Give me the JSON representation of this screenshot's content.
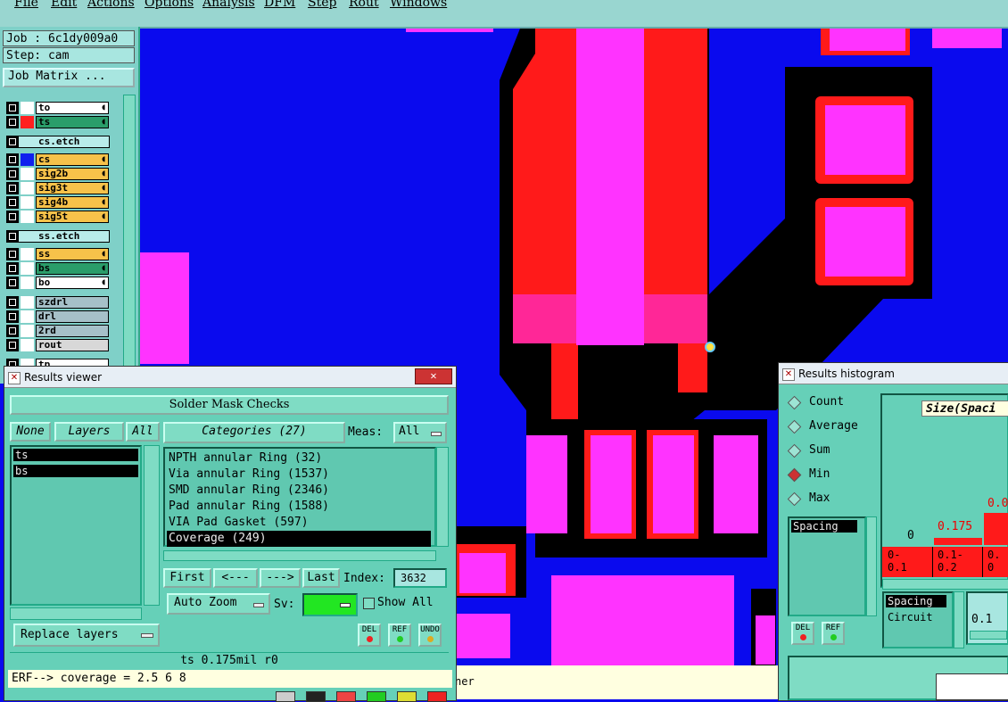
{
  "menu": [
    "File",
    "Edit",
    "Actions",
    "Options",
    "Analysis",
    "DFM",
    "Step",
    "Rout",
    "Windows"
  ],
  "job": {
    "job_label": "Job : 6c1dy009a0",
    "step_label": "Step: cam",
    "matrix_button": "Job Matrix ..."
  },
  "layers": [
    {
      "name": "to",
      "color": "#ffffff",
      "swatch": "#ffffff",
      "group": 1
    },
    {
      "name": "ts",
      "color": "#2a9d6a",
      "swatch": "#ff2020",
      "group": 1
    },
    {
      "name": "cs.etch",
      "sep": true
    },
    {
      "name": "cs",
      "color": "#f7c24a",
      "swatch": "#1020ee",
      "group": 2
    },
    {
      "name": "sig2b",
      "color": "#f7c24a",
      "swatch": "#ffffff",
      "group": 2
    },
    {
      "name": "sig3t",
      "color": "#f7c24a",
      "swatch": "#ffffff",
      "group": 2
    },
    {
      "name": "sig4b",
      "color": "#f7c24a",
      "swatch": "#ffffff",
      "group": 2
    },
    {
      "name": "sig5t",
      "color": "#f7c24a",
      "swatch": "#ffffff",
      "group": 2
    },
    {
      "name": "ss.etch",
      "sep": true
    },
    {
      "name": "ss",
      "color": "#f7c24a",
      "swatch": "#ffffff",
      "group": 3
    },
    {
      "name": "bs",
      "color": "#2a9d6a",
      "swatch": "#ffffff",
      "group": 3
    },
    {
      "name": "bo",
      "color": "#ffffff",
      "swatch": "#ffffff",
      "group": 3
    },
    {
      "name": "szdrl",
      "color": "#a6c0c8",
      "swatch": "#ffffff",
      "group": 4
    },
    {
      "name": "drl",
      "color": "#a6c0c8",
      "swatch": "#ffffff",
      "group": 4
    },
    {
      "name": "2rd",
      "color": "#a6c0c8",
      "swatch": "#ffffff",
      "group": 4
    },
    {
      "name": "rout",
      "color": "#d8d8d8",
      "swatch": "#ffffff",
      "group": 4
    },
    {
      "name": "tp",
      "color": "#ffffff",
      "swatch": "#ffffff",
      "group": 5
    }
  ],
  "results_viewer": {
    "title": "Results viewer",
    "heading": "Solder Mask Checks",
    "none_btn": "None",
    "layers_btn": "Layers",
    "all_btn": "All",
    "layer_items": [
      "ts",
      "bs"
    ],
    "categories_btn": "Categories (27)",
    "meas_label": "Meas:",
    "meas_value": "All",
    "categories": [
      "NPTH annular Ring (32)",
      "Via annular Ring (1537)",
      "SMD annular Ring (2346)",
      "Pad annular Ring (1588)",
      "VIA Pad Gasket (597)",
      "Coverage (249)"
    ],
    "first_btn": "First",
    "prev_btn": "<---",
    "next_btn": "--->",
    "last_btn": "Last",
    "index_label": "Index:",
    "index_value": "3632",
    "auto_zoom": "Auto Zoom",
    "sv_label": "Sv:",
    "show_all": "Show All",
    "replace_layers": "Replace layers",
    "del": "DEL",
    "ref": "REF",
    "undo": "UNDO",
    "status": "ts 0.175mil  r0",
    "erf": "ERF--> coverage = 2.5 6 8"
  },
  "histogram": {
    "title": "Results histogram",
    "options": [
      "Count",
      "Average",
      "Sum",
      "Min",
      "Max"
    ],
    "selected": "Min",
    "size_label": "Size(Spaci",
    "list_item": "Spacing",
    "bar_labels": [
      "0",
      "0.175",
      "0.0"
    ],
    "range_labels": [
      "0-\n0.1",
      "0.1-\n0.2",
      "0.\n0"
    ],
    "lower_items": [
      "Spacing",
      "Circuit"
    ],
    "lower_value": "0.1",
    "del": "DEL",
    "ref": "REF"
  },
  "status_strip": "ner",
  "colors": {
    "board_blue": "#0a0aee",
    "pad_red": "#ff1a1a",
    "mask_magenta": "#ff33ff",
    "panel_teal": "#66d0b8"
  }
}
